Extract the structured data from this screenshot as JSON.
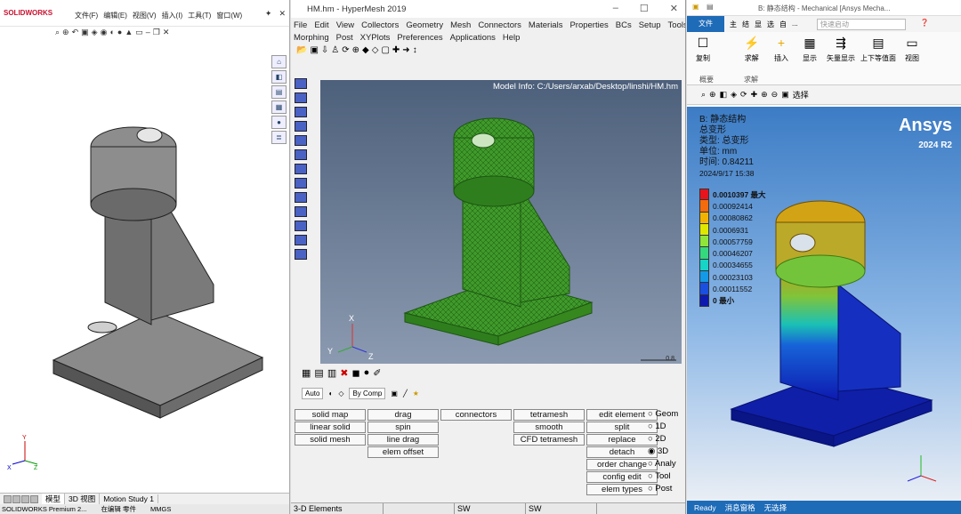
{
  "solidworks": {
    "logo": "SOLIDWORKS",
    "menu": [
      "文件(F)",
      "编辑(E)",
      "视图(V)",
      "插入(I)",
      "工具(T)",
      "窗口(W)"
    ],
    "tabs": [
      "模型",
      "3D 视图",
      "Motion Study 1"
    ],
    "active_tab": "模型",
    "status": [
      "SOLIDWORKS Premium 2...",
      "在编辑 零件",
      "MMGS"
    ]
  },
  "hypermesh": {
    "title": "HM.hm - HyperMesh 2019",
    "menu": [
      "File",
      "Edit",
      "View",
      "Collectors",
      "Geometry",
      "Mesh",
      "Connectors",
      "Materials",
      "Properties",
      "BCs",
      "Setup",
      "Tools",
      "Morphing",
      "Post",
      "XYPlots",
      "Preferences",
      "Applications",
      "Help"
    ],
    "model_info": "Model Info: C:/Users/arxab/Desktop/linshi/HM.hm",
    "scale_label": "0.8",
    "axis": {
      "x": "X",
      "y": "Y",
      "z": "Z"
    },
    "display_mode": "Auto",
    "color_mode": "By Comp",
    "panel_col1": [
      "solid map",
      "linear solid",
      "solid mesh"
    ],
    "panel_col2": [
      "drag",
      "spin",
      "line drag",
      "elem offset"
    ],
    "panel_col3": [
      "connectors"
    ],
    "panel_col4": [
      "tetramesh",
      "smooth",
      "CFD tetramesh"
    ],
    "panel_col5": [
      "edit element",
      "split",
      "replace",
      "detach",
      "order change",
      "config edit",
      "elem types"
    ],
    "radio": [
      "Geom",
      "1D",
      "2D",
      "3D",
      "Analy",
      "Tool",
      "Post"
    ],
    "radio_selected": "3D",
    "status": [
      "3-D Elements",
      "SW",
      "SW"
    ]
  },
  "ansys": {
    "title": "B: 静态结构 - Mechanical [Ansys Mecha...",
    "tabs": [
      "文件",
      "主",
      "结",
      "显",
      "选",
      "自",
      "...",
      "快速启动"
    ],
    "ribbon": [
      "复制",
      "求解",
      "插入",
      "显示",
      "矢量显示",
      "上下等值面",
      "视图"
    ],
    "ribbon_groups": [
      "概要",
      "求解"
    ],
    "toolbar_label": "选择",
    "brand": "Ansys",
    "version": "2024 R2",
    "info": [
      "B: 静态结构",
      "总变形",
      "类型: 总变形",
      "单位: mm",
      "时间: 0.84211",
      "2024/9/17 15:38"
    ],
    "legend": [
      {
        "label": "0.0010397 最大",
        "color": "#e8141c"
      },
      {
        "label": "0.00092414",
        "color": "#f26b0d"
      },
      {
        "label": "0.00080862",
        "color": "#f2b300"
      },
      {
        "label": "0.0006931",
        "color": "#dfe700"
      },
      {
        "label": "0.00057759",
        "color": "#90e43a"
      },
      {
        "label": "0.00046207",
        "color": "#35d87d"
      },
      {
        "label": "0.00034655",
        "color": "#18d4c6"
      },
      {
        "label": "0.00023103",
        "color": "#1499e6"
      },
      {
        "label": "0.00011552",
        "color": "#1a4fe0"
      },
      {
        "label": "0 最小",
        "color": "#0d1ab0"
      }
    ],
    "status": [
      "Ready",
      "消息窗格",
      "无选择"
    ]
  }
}
